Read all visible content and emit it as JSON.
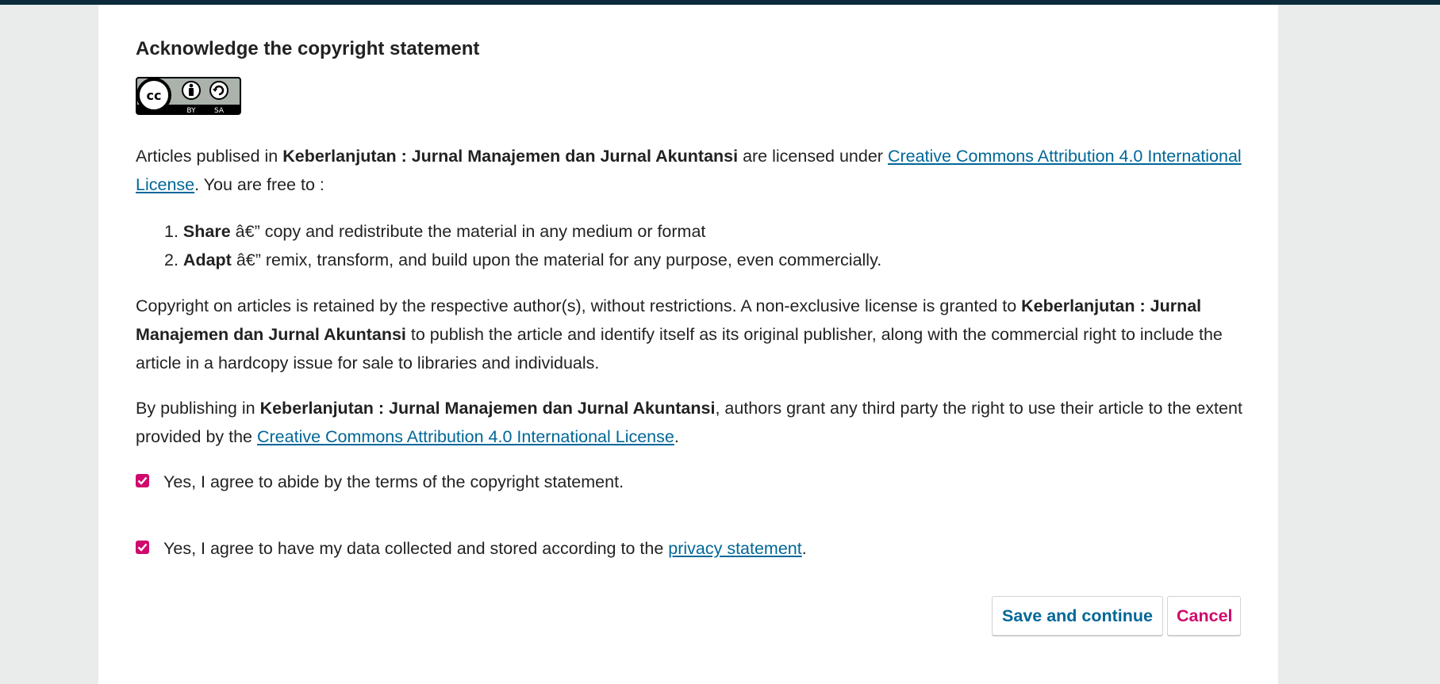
{
  "heading": "Acknowledge the copyright statement",
  "license_badge": {
    "icon": "cc-by-sa-badge",
    "by_text": "BY",
    "sa_text": "SA"
  },
  "paragraph1": {
    "prefix": "Articles publised in ",
    "journal": "Keberlanjutan : Jurnal Manajemen dan Jurnal Akuntansi",
    "middle": " are licensed under ",
    "link": "Creative Commons Attribution 4.0 International License",
    "suffix": ". You are free to :"
  },
  "freedoms": [
    {
      "number": "1.",
      "term": "Share",
      "desc": " â€” copy and redistribute the material in any medium or format"
    },
    {
      "number": "2.",
      "term": "Adapt",
      "desc": " â€” remix, transform, and build upon the material for any purpose, even commercially."
    }
  ],
  "paragraph2": {
    "prefix": "Copyright on articles is retained by the respective author(s), without restrictions. A non-exclusive license is granted to ",
    "journal": "Keberlanjutan : Jurnal Manajemen dan Jurnal Akuntansi",
    "suffix": " to publish the article and identify itself as its original publisher, along with the commercial right to include the article in a hardcopy issue for sale to libraries and individuals."
  },
  "paragraph3": {
    "prefix": "By publishing in ",
    "journal": "Keberlanjutan : Jurnal Manajemen dan Jurnal Akuntansi",
    "middle": ", authors grant any third party the right to use their article to the extent provided by the ",
    "link": "Creative Commons Attribution 4.0 International License",
    "suffix": "."
  },
  "checkboxes": {
    "copyright": {
      "checked": true,
      "label": "Yes, I agree to abide by the terms of the copyright statement."
    },
    "privacy": {
      "checked": true,
      "prefix": "Yes, I agree to have my data collected and stored according to the ",
      "link": "privacy statement",
      "suffix": "."
    }
  },
  "buttons": {
    "save": "Save and continue",
    "cancel": "Cancel"
  },
  "colors": {
    "topbar": "#0c2b3d",
    "link": "#006798",
    "accent": "#d00a6c",
    "background": "#e9eceb"
  }
}
